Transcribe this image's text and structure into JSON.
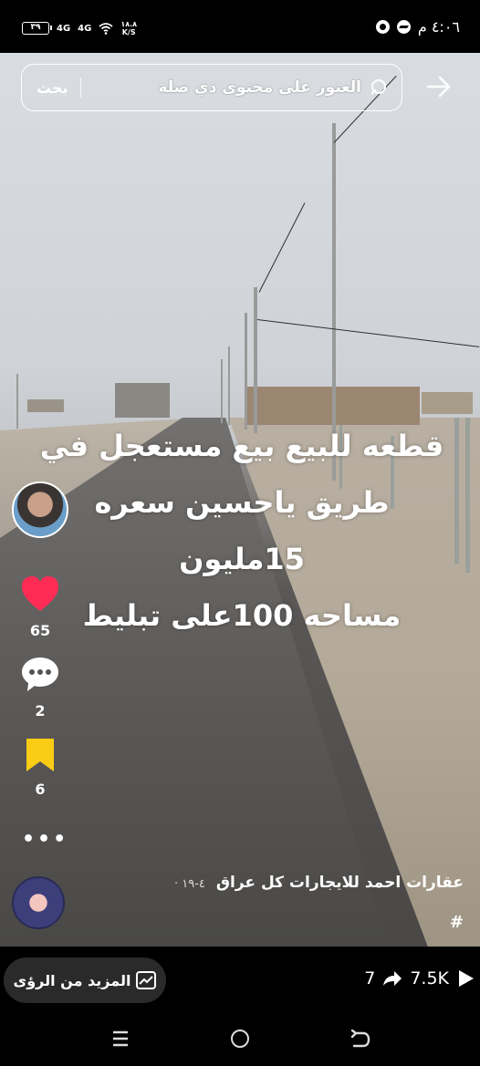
{
  "status_bar": {
    "battery": "٣٩",
    "signal_1": "4G",
    "signal_2": "4G",
    "net_speed_value": "١٨.٨",
    "net_speed_unit": "K/S",
    "time": "٤:٠٦ م"
  },
  "search": {
    "placeholder": "العثور على محتوى ذي صلة",
    "button_label": "بحث"
  },
  "caption": {
    "lines": [
      "قطعه للبيع بيع مستعجل في",
      "طريق ياحسين سعره 15مليون",
      "مساحه 100على تبليط"
    ]
  },
  "actions": {
    "likes": "65",
    "comments": "2",
    "favorites": "6"
  },
  "channel": {
    "name": "عقارات احمد للايجارات كل عراق",
    "date": "٤-١٩ ·",
    "hashtag": "#"
  },
  "bottom_bar": {
    "insights_label": "المزيد من الرؤى",
    "shares": "7",
    "views": "7.5K"
  },
  "colors": {
    "heart": "#fe2c55",
    "bookmark": "#facc15",
    "background": "#000000"
  }
}
